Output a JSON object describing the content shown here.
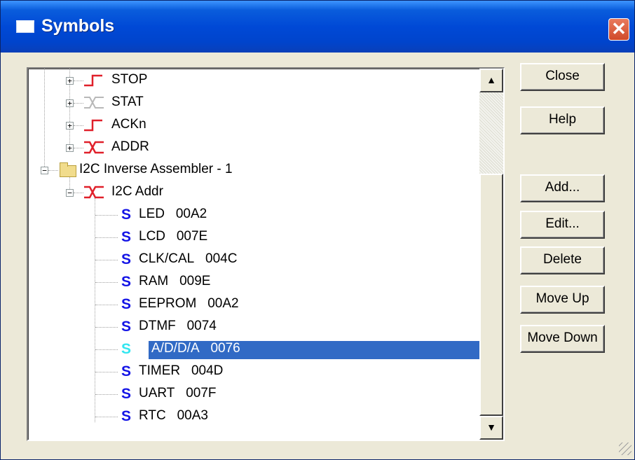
{
  "window": {
    "title": "Symbols"
  },
  "tree": {
    "top_items": [
      {
        "label": "STOP",
        "icon": "red-rising-edge-icon"
      },
      {
        "label": "STAT",
        "icon": "gray-transition-icon"
      },
      {
        "label": "ACKn",
        "icon": "red-rising-edge-icon"
      },
      {
        "label": "ADDR",
        "icon": "red-transition-icon"
      }
    ],
    "folder": {
      "label": "I2C Inverse Assembler - 1"
    },
    "group": {
      "label": "I2C Addr"
    },
    "symbol_glyph": "S",
    "symbols": [
      {
        "name": "LED",
        "value": "00A2"
      },
      {
        "name": "LCD",
        "value": "007E"
      },
      {
        "name": "CLK/CAL",
        "value": "004C"
      },
      {
        "name": "RAM",
        "value": "009E"
      },
      {
        "name": "EEPROM",
        "value": "00A2"
      },
      {
        "name": "DTMF",
        "value": "0074"
      },
      {
        "name": "A/D/D/A",
        "value": "0076"
      },
      {
        "name": "TIMER",
        "value": "004D"
      },
      {
        "name": "UART",
        "value": "007F"
      },
      {
        "name": "RTC",
        "value": "00A3"
      }
    ],
    "selected_symbol": "A/D/D/A"
  },
  "buttons": {
    "close": "Close",
    "help": "Help",
    "add": "Add...",
    "edit": "Edit...",
    "delete": "Delete",
    "move_up": "Move Up",
    "move_down": "Move Down"
  },
  "colors": {
    "selection": "#316AC5",
    "signal_red": "#E0202A",
    "symbol_blue": "#1414E6"
  }
}
